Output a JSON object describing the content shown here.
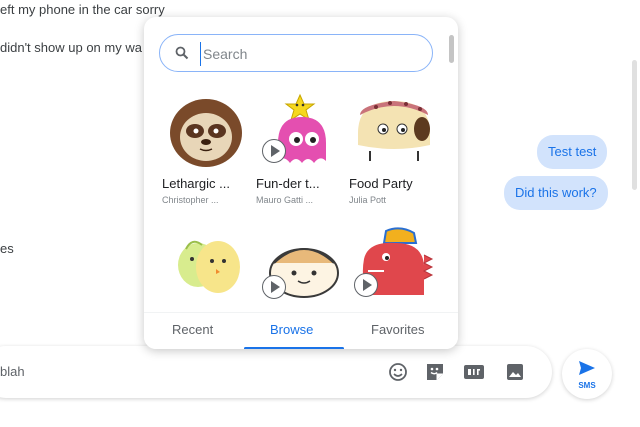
{
  "conversation": {
    "incoming": [
      "eft my phone in the car sorry",
      "didn't show up on my wa",
      "es"
    ],
    "outgoing": [
      "Test test",
      "Did this work?"
    ]
  },
  "picker": {
    "search_placeholder": "Search",
    "stickers": [
      {
        "title": "Lethargic ...",
        "author": "Christopher ...",
        "animated": false
      },
      {
        "title": "Fun-der t...",
        "author": "Mauro Gatti ...",
        "animated": true
      },
      {
        "title": "Food Party",
        "author": "Julia Pott",
        "animated": false
      },
      {
        "title": "",
        "author": "",
        "animated": false
      },
      {
        "title": "",
        "author": "",
        "animated": true
      },
      {
        "title": "",
        "author": "",
        "animated": true
      }
    ],
    "tabs": {
      "recent": "Recent",
      "browse": "Browse",
      "favorites": "Favorites",
      "active": "browse"
    }
  },
  "compose": {
    "text": "blah",
    "icons": [
      "emoji-icon",
      "sticker-icon",
      "gif-icon",
      "image-icon"
    ],
    "send_label": "SMS"
  },
  "colors": {
    "accent": "#1a73e8",
    "bubble": "#d2e3fc"
  }
}
